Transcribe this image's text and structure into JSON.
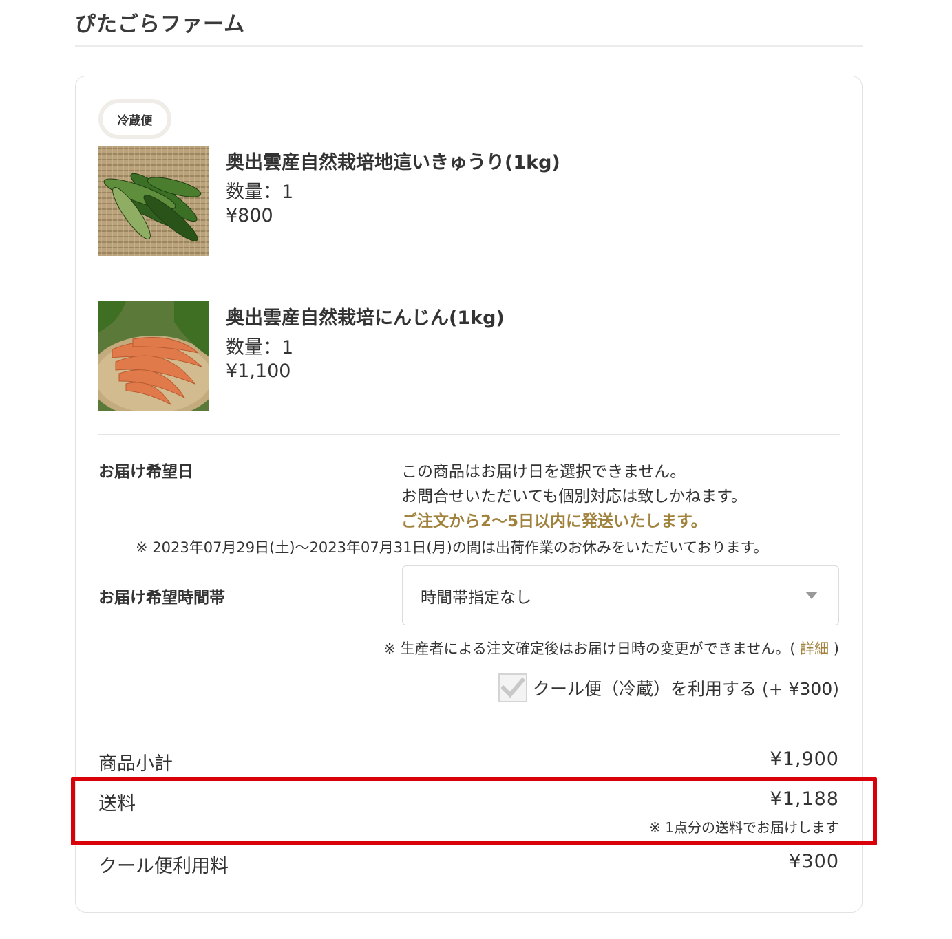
{
  "shop": {
    "name": "ぴたごらファーム"
  },
  "shipping_group": {
    "badge": "冷蔵便"
  },
  "items": [
    {
      "name": "奥出雲産自然栽培地這いきゅうり(1kg)",
      "quantity": "数量：1",
      "price": "¥800",
      "image": "cucumber-photo"
    },
    {
      "name": "奥出雲産自然栽培にんじん(1kg)",
      "quantity": "数量：1",
      "price": "¥1,100",
      "image": "carrot-photo"
    }
  ],
  "delivery": {
    "date_label": "お届け希望日",
    "date_message_1": "この商品はお届け日を選択できません。",
    "date_message_2": "お問合せいただいても個別対応は致しかねます。",
    "date_message_accent": "ご注文から2〜5日以内に発送いたします。",
    "holiday_note": "※ 2023年07月29日(土)〜2023年07月31日(月)の間は出荷作業のお休みをいただいております。",
    "time_label": "お届け希望時間帯",
    "time_selected": "時間帯指定なし",
    "change_note_prefix": "※ 生産者による注文確定後はお届け日時の変更ができません。(",
    "change_note_link": "詳細",
    "change_note_suffix": ")",
    "cool_option_label": "クール便（冷蔵）を利用する (+ ¥300)",
    "cool_option_checked": true
  },
  "summary": {
    "subtotal_label": "商品小計",
    "subtotal_value": "¥1,900",
    "shipping_label": "送料",
    "shipping_value": "¥1,188",
    "shipping_note": "※ 1点分の送料でお届けします",
    "cool_fee_label": "クール便利用料",
    "cool_fee_value": "¥300"
  },
  "colors": {
    "accent": "#a0823c",
    "highlight": "#d9000a",
    "border": "#e2e2e2"
  }
}
